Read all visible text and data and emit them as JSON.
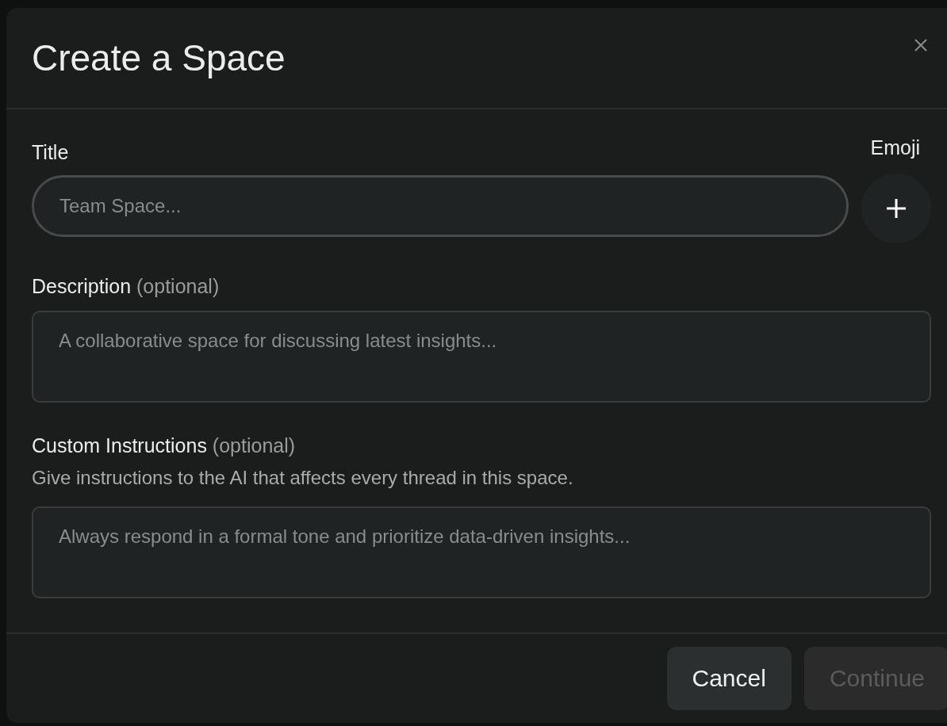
{
  "dialog": {
    "title": "Create a Space"
  },
  "title_field": {
    "label": "Title",
    "placeholder": "Team Space..."
  },
  "emoji": {
    "label": "Emoji"
  },
  "description_field": {
    "label": "Description",
    "hint": "(optional)",
    "placeholder": "A collaborative space for discussing latest insights..."
  },
  "instructions_field": {
    "label": "Custom Instructions",
    "hint": "(optional)",
    "help": "Give instructions to the AI that affects every thread in this space.",
    "placeholder": "Always respond in a formal tone and prioritize data-driven insights..."
  },
  "buttons": [
    {
      "label": "Cancel",
      "disabled": false
    },
    {
      "label": "Continue",
      "disabled": true
    }
  ]
}
